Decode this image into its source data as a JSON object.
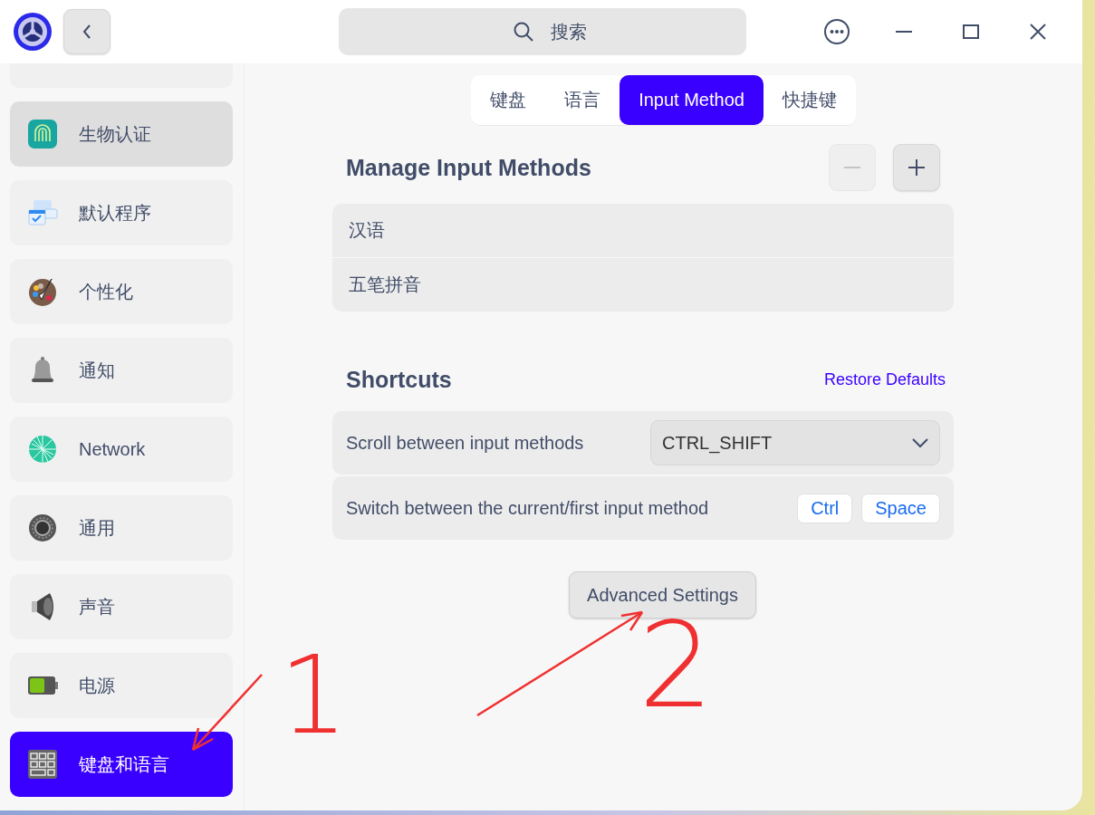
{
  "titlebar": {
    "search": {
      "placeholder": "搜索"
    }
  },
  "sidebar": {
    "items": [
      {
        "label": "生物认证",
        "highlighted": true,
        "selected": false
      },
      {
        "label": "默认程序",
        "highlighted": false,
        "selected": false
      },
      {
        "label": "个性化",
        "highlighted": false,
        "selected": false
      },
      {
        "label": "通知",
        "highlighted": false,
        "selected": false
      },
      {
        "label": "Network",
        "highlighted": false,
        "selected": false
      },
      {
        "label": "通用",
        "highlighted": false,
        "selected": false
      },
      {
        "label": "声音",
        "highlighted": false,
        "selected": false
      },
      {
        "label": "电源",
        "highlighted": false,
        "selected": false
      },
      {
        "label": "键盘和语言",
        "highlighted": false,
        "selected": true
      }
    ]
  },
  "tabs": [
    {
      "label": "键盘",
      "selected": false
    },
    {
      "label": "语言",
      "selected": false
    },
    {
      "label": "Input Method",
      "selected": true
    },
    {
      "label": "快捷键",
      "selected": false
    }
  ],
  "manage": {
    "title": "Manage Input Methods",
    "remove_disabled": true,
    "add_disabled": false,
    "methods": [
      "汉语",
      "五笔拼音"
    ]
  },
  "shortcuts": {
    "title": "Shortcuts",
    "restore": "Restore Defaults",
    "rows": [
      {
        "kind": "dropdown",
        "label": "Scroll between input methods",
        "value": "CTRL_SHIFT"
      },
      {
        "kind": "keys",
        "label": "Switch between the current/first input method",
        "keys": [
          "Ctrl",
          "Space"
        ]
      }
    ]
  },
  "advanced_button": "Advanced Settings",
  "annotations": [
    {
      "kind": "arrow"
    },
    {
      "kind": "mark",
      "text": "1"
    },
    {
      "kind": "arrow"
    },
    {
      "kind": "mark",
      "text": "2"
    }
  ]
}
